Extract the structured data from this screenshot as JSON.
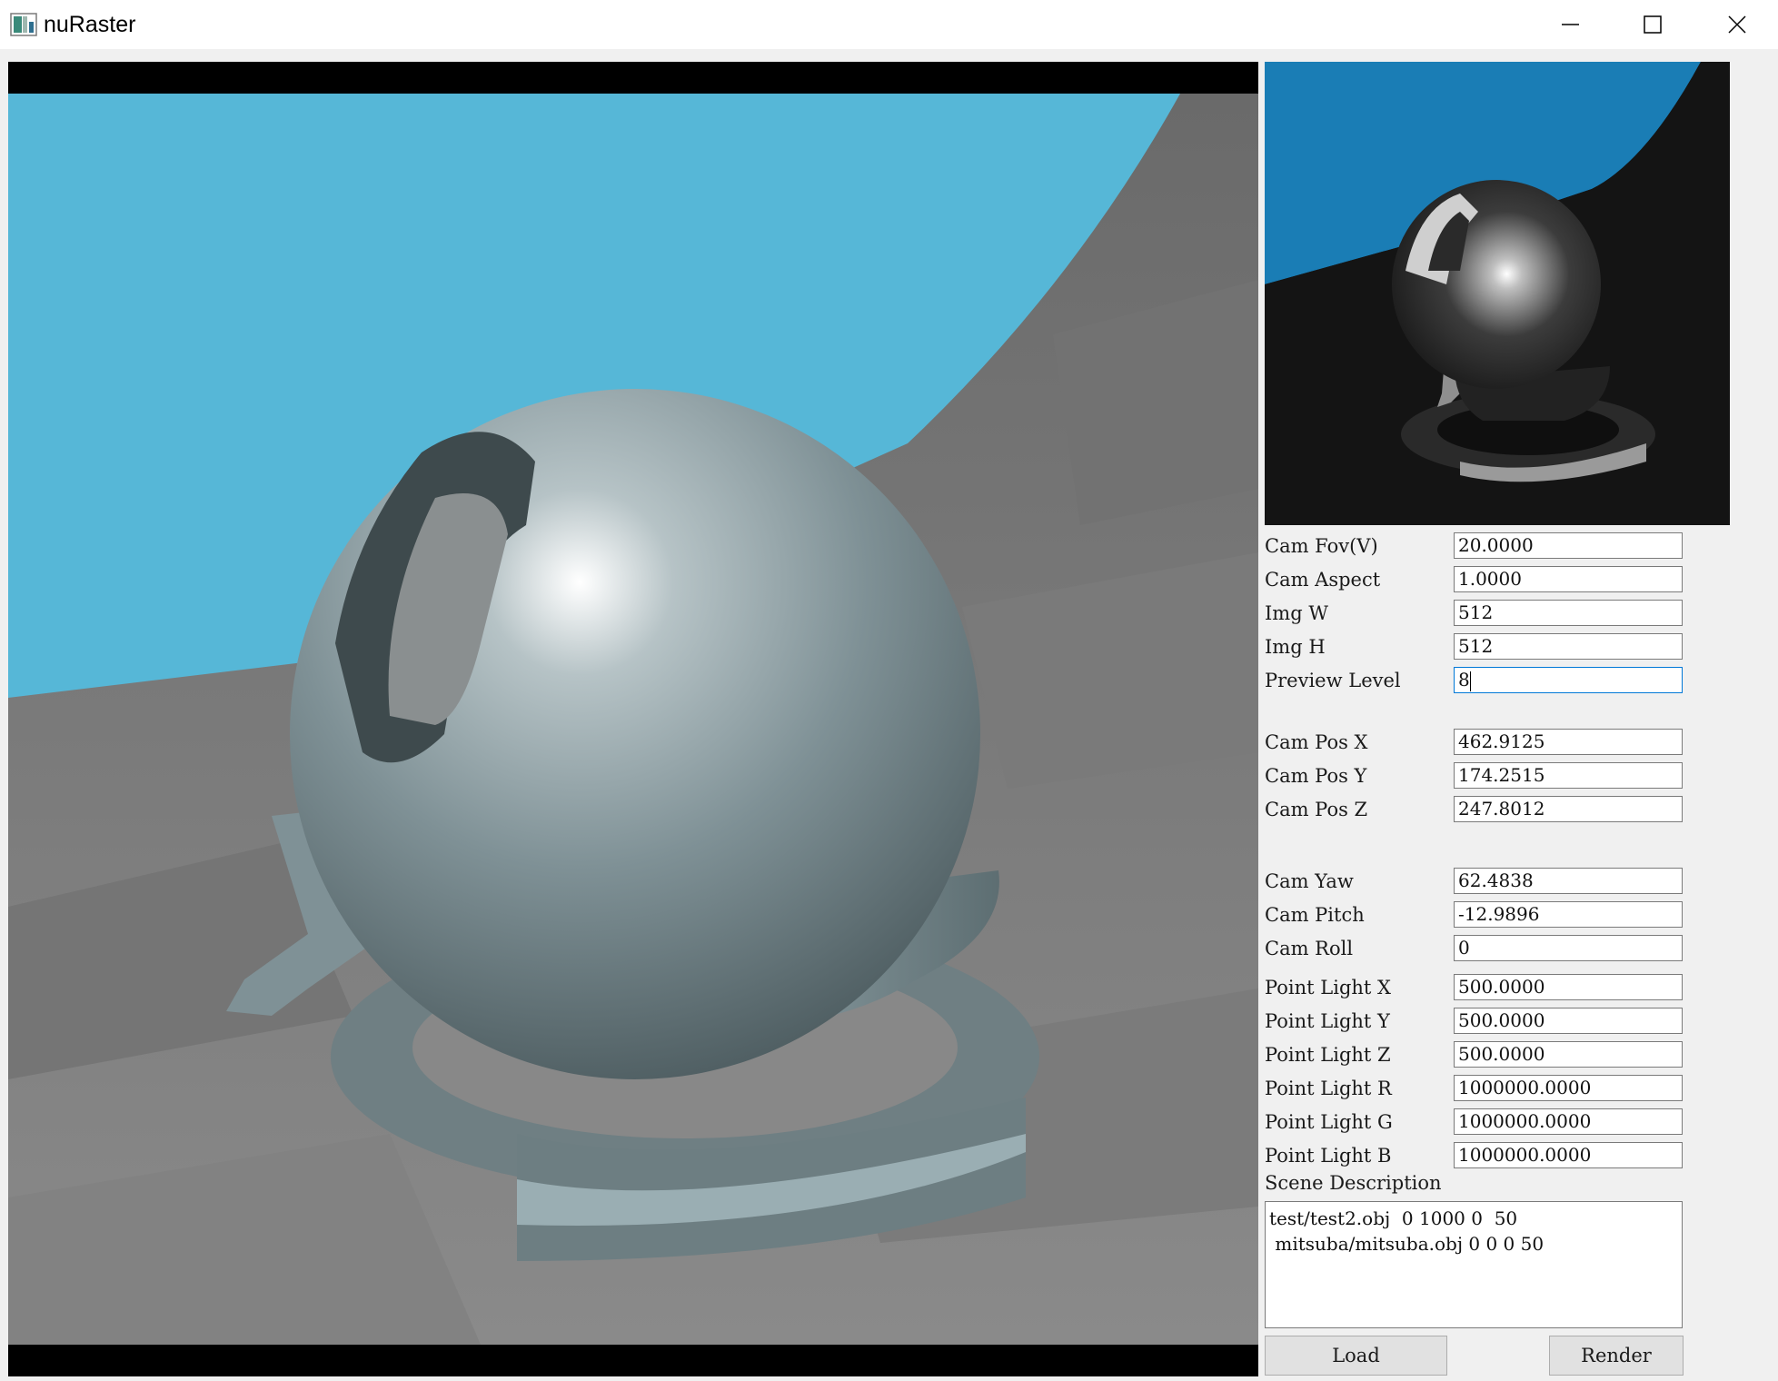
{
  "window": {
    "title": "nuRaster",
    "controls": {
      "minimize": "minimize",
      "maximize": "maximize",
      "close": "close"
    }
  },
  "colors": {
    "sky": "#56b7d7",
    "preview_sky": "#1a7db5",
    "floor_light": "#8a8a8a",
    "floor_dark": "#6f6f6f",
    "model": "#7f9196",
    "focus_border": "#0078d7"
  },
  "camera_fields": [
    {
      "label": "Cam Fov(V)",
      "value": "20.0000"
    },
    {
      "label": "Cam Aspect",
      "value": "1.0000"
    },
    {
      "label": "Img W",
      "value": "512"
    },
    {
      "label": "Img H",
      "value": "512"
    },
    {
      "label": "Preview Level",
      "value": "8"
    }
  ],
  "position_fields": [
    {
      "label": "Cam Pos X",
      "value": "462.9125"
    },
    {
      "label": "Cam Pos Y",
      "value": "174.2515"
    },
    {
      "label": "Cam Pos Z",
      "value": "247.8012"
    }
  ],
  "rotation_fields": [
    {
      "label": "Cam Yaw",
      "value": "62.4838"
    },
    {
      "label": "Cam Pitch",
      "value": "-12.9896"
    },
    {
      "label": "Cam Roll",
      "value": "0"
    }
  ],
  "light_fields": [
    {
      "label": "Point Light X",
      "value": "500.0000"
    },
    {
      "label": "Point Light Y",
      "value": "500.0000"
    },
    {
      "label": "Point Light Z",
      "value": "500.0000"
    },
    {
      "label": "Point Light R",
      "value": "1000000.0000"
    },
    {
      "label": "Point Light G",
      "value": "1000000.0000"
    },
    {
      "label": "Point Light B",
      "value": "1000000.0000"
    }
  ],
  "scene": {
    "label": "Scene Description",
    "lines": [
      "test/test2.obj  0 1000 0  50",
      " mitsuba/mitsuba.obj 0 0 0 50"
    ]
  },
  "buttons": {
    "load": "Load",
    "render": "Render"
  }
}
